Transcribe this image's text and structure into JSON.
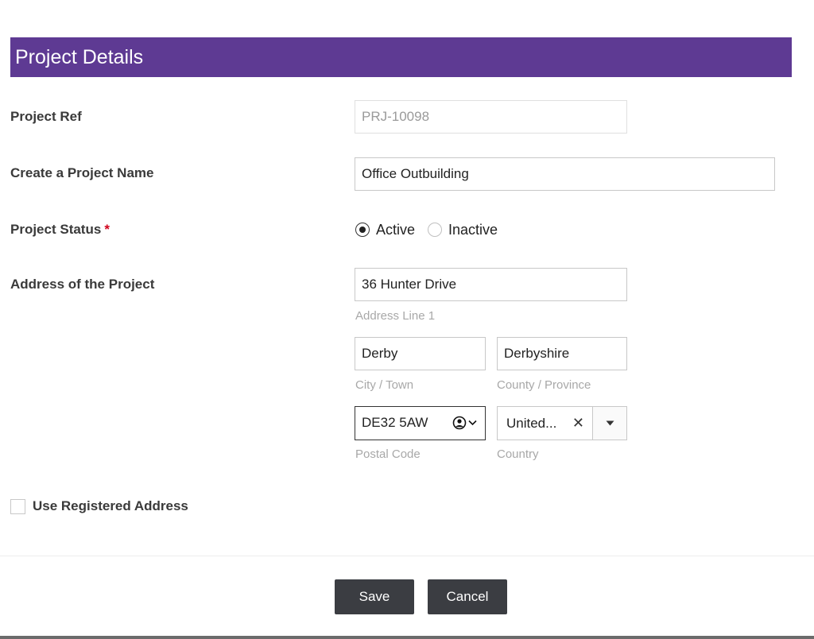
{
  "header": {
    "title": "Project Details"
  },
  "fields": {
    "project_ref": {
      "label": "Project Ref",
      "value": "PRJ-10098"
    },
    "project_name": {
      "label": "Create a Project Name",
      "value": "Office Outbuilding"
    },
    "project_status": {
      "label": "Project Status",
      "required_mark": "*",
      "options": [
        {
          "label": "Active",
          "checked": true
        },
        {
          "label": "Inactive",
          "checked": false
        }
      ]
    },
    "address": {
      "label": "Address of the Project",
      "line1": {
        "value": "36 Hunter Drive",
        "hint": "Address Line 1"
      },
      "city": {
        "value": "Derby",
        "hint": "City / Town"
      },
      "county": {
        "value": "Derbyshire",
        "hint": "County / Province"
      },
      "postal_code": {
        "value": "DE32 5AW",
        "hint": "Postal Code"
      },
      "country": {
        "value": "United...",
        "hint": "Country",
        "clear_glyph": "✕"
      }
    }
  },
  "use_registered_address": {
    "label": "Use Registered Address",
    "checked": false
  },
  "actions": {
    "save_label": "Save",
    "cancel_label": "Cancel"
  }
}
